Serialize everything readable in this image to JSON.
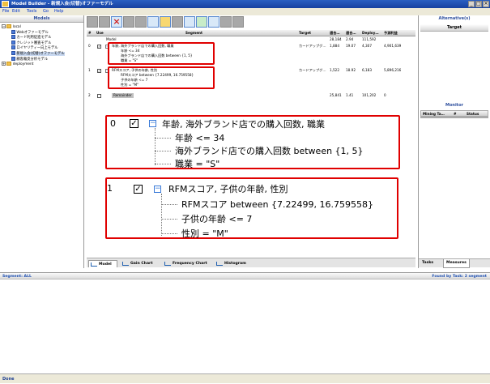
{
  "window": {
    "title": "Model Builder - 新規入会(切替)オファーモデル"
  },
  "menu": [
    "File",
    "Edit",
    "Tools",
    "Go",
    "Help"
  ],
  "left_panel": {
    "header": "Models",
    "tree": [
      {
        "label": "local",
        "level": 0,
        "kind": "folder",
        "expander": "−"
      },
      {
        "label": "Webオファーモデル",
        "level": 1,
        "kind": "model"
      },
      {
        "label": "カード利用促進モデル",
        "level": 1,
        "kind": "model"
      },
      {
        "label": "クレジット審査モデル",
        "level": 1,
        "kind": "model"
      },
      {
        "label": "ロイヤリティー向上モデル",
        "level": 1,
        "kind": "model"
      },
      {
        "label": "新規入会(切替)オファーモデル",
        "level": 1,
        "kind": "model",
        "selected": true
      },
      {
        "label": "顧客離反分析モデル",
        "level": 1,
        "kind": "model"
      },
      {
        "label": "deployment",
        "level": 0,
        "kind": "folder",
        "expander": "+"
      }
    ]
  },
  "grid": {
    "headers": {
      "num": "#",
      "use": "Use",
      "segment": "Segment",
      "target": "Target",
      "c1": "適合…",
      "c2": "適合…",
      "c3": "Deploy…",
      "c4": "予測利益"
    },
    "model_row": {
      "label": "Model",
      "c1": "28,184",
      "c2": "2.94",
      "c3": "111,592",
      "c4": ""
    },
    "rows": [
      {
        "num": "0",
        "checked": true,
        "segment": "年齢, 海外ブランド店での購入回数, 職業",
        "target": "カードアップグ…",
        "c1": "1,884",
        "c2": "19.07",
        "c3": "4,307",
        "c4": "4,901,639",
        "conditions": [
          "年齢 <= 34",
          "海外ブランド店での購入回数 between {1, 5}",
          "職業 = \"S\""
        ]
      },
      {
        "num": "1",
        "checked": true,
        "segment": "RFMスコア, 子供の年齢, 性別",
        "target": "カードアップグ…",
        "c1": "1,522",
        "c2": "18.92",
        "c3": "6,183",
        "c4": "5,896,216",
        "conditions": [
          "RFMスコア between {7.22499, 16.759558}",
          "子供の年齢 <= 7",
          "性別 = \"M\""
        ]
      },
      {
        "num": "2",
        "checked": false,
        "segment": "Remainder",
        "target": "",
        "c1": "25,841",
        "c2": "1.41",
        "c3": "101,202",
        "c4": "0",
        "conditions": []
      }
    ]
  },
  "zoom": {
    "box1": {
      "num": "0",
      "title": "年齢, 海外ブランド店での購入回数, 職業",
      "lines": [
        "年齢 <= 34",
        "海外ブランド店での購入回数 between {1, 5}",
        "職業 = \"S\""
      ]
    },
    "box2": {
      "num": "1",
      "title": "RFMスコア, 子供の年齢, 性別",
      "lines": [
        "RFMスコア between {7.22499, 16.759558}",
        "子供の年齢 <= 7",
        "性別 = \"M\""
      ]
    }
  },
  "bottom_tabs": [
    "Model",
    "Gain Chart",
    "Frequency Chart",
    "Histogram"
  ],
  "right_panel": {
    "header": "Alternative(s)",
    "target_col": "Target",
    "monitor_header": "Monitor",
    "monitor_cols": [
      "Mining Ta…",
      "#",
      "Status"
    ],
    "tabs": [
      "Tasks",
      "Measures"
    ]
  },
  "segment_bar": {
    "left": "Segment: ALL",
    "right": "Found by Task: 2 segment"
  },
  "status": "Done"
}
